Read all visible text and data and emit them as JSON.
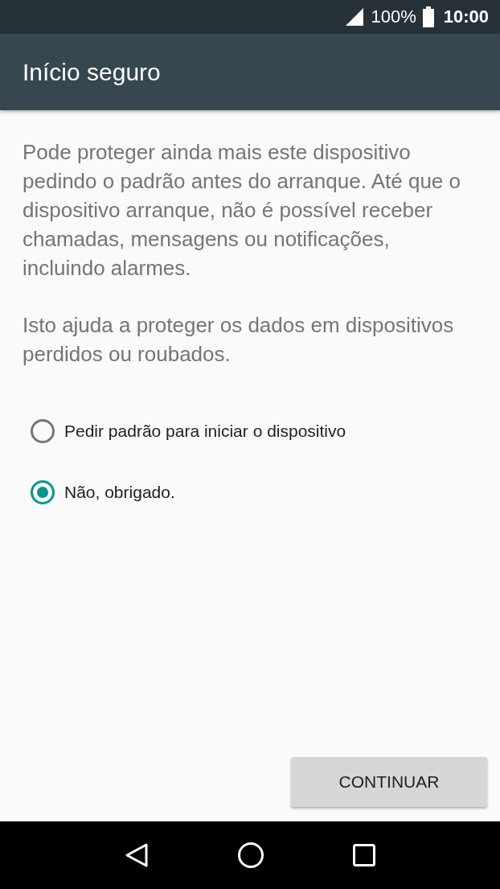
{
  "status_bar": {
    "battery": "100%",
    "time": "10:00"
  },
  "app_bar": {
    "title": "Início seguro"
  },
  "paragraphs": [
    "Pode proteger ainda mais este dispositivo pedindo o padrão antes do arranque. Até que o dispositivo arranque, não é possível receber chamadas, mensagens ou notificações, incluindo alarmes.",
    "Isto ajuda a proteger os dados em dispositivos perdidos ou roubados."
  ],
  "options": [
    {
      "label": "Pedir padrão para iniciar o dispositivo",
      "selected": false
    },
    {
      "label": "Não, obrigado.",
      "selected": true
    }
  ],
  "buttons": [
    "CONTINUAR"
  ]
}
